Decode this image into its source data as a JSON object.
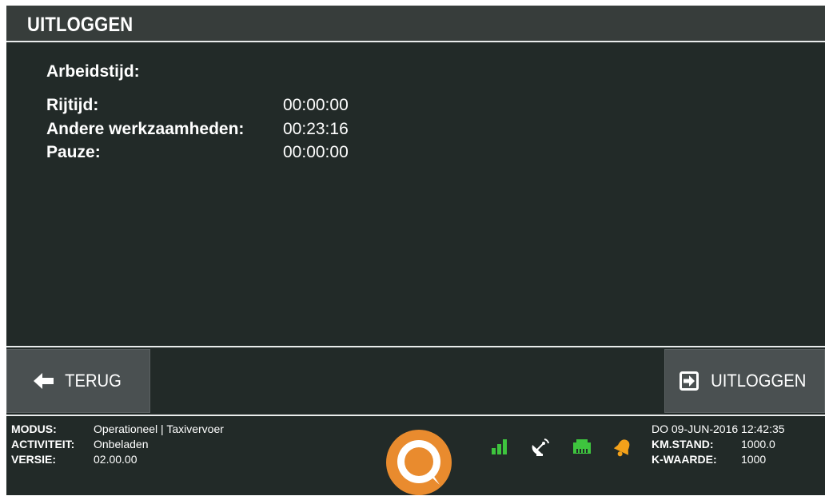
{
  "header": {
    "title": "UITLOGGEN"
  },
  "summary": {
    "heading": "Arbeidstijd:",
    "rows": [
      {
        "label": "Rijtijd:",
        "value": "00:00:00"
      },
      {
        "label": "Andere werkzaamheden:",
        "value": "00:23:16"
      },
      {
        "label": "Pauze:",
        "value": "00:00:00"
      }
    ]
  },
  "nav": {
    "back_label": "TERUG",
    "logout_label": "UITLOGGEN"
  },
  "status": {
    "left": [
      {
        "label": "MODUS:",
        "value": "Operationeel | Taxivervoer"
      },
      {
        "label": "ACTIVITEIT:",
        "value": "Onbeladen"
      },
      {
        "label": "VERSIE:",
        "value": "02.00.00"
      }
    ],
    "datetime": "DO 09-JUN-2016 12:42:35",
    "right": [
      {
        "label": "KM.STAND:",
        "value": "1000.0"
      },
      {
        "label": "K-WAARDE:",
        "value": "1000"
      }
    ],
    "icons": [
      "signal-bars-icon",
      "satellite-dish-icon",
      "network-port-icon",
      "bell-icon"
    ]
  },
  "colors": {
    "background": "#222a28",
    "titlebar": "#373d3b",
    "button": "#4a5051",
    "logo": "#e98b2e",
    "icon_green": "#3ec43e",
    "bell": "#f3a11a"
  }
}
